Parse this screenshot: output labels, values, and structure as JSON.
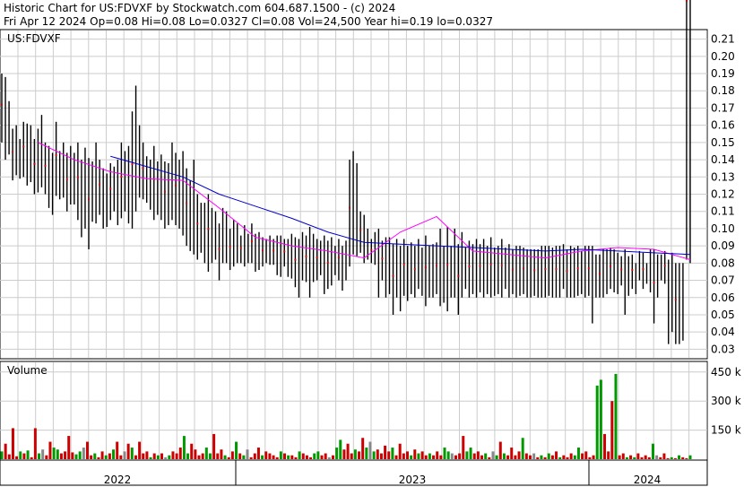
{
  "header": {
    "line1": "Historic Chart for US:FDVXF by Stockwatch.com 604.687.1500 - (c) 2024",
    "line2": "Fri Apr 12 2024  Op=0.08  Hi=0.08  Lo=0.0327  Cl=0.08  Vol=24,500  Year hi=0.19  lo=0.0327"
  },
  "chart_data": {
    "type": "line",
    "subtype": "ohlc-bars-with-moving-averages",
    "price_panel": {
      "symbol_label": "US:FDVXF",
      "ylim": [
        0.025,
        0.215
      ],
      "y_ticks": [
        0.21,
        0.2,
        0.19,
        0.18,
        0.17,
        0.16,
        0.15,
        0.14,
        0.13,
        0.12,
        0.11,
        0.1,
        0.09,
        0.08,
        0.07,
        0.06,
        0.05,
        0.04,
        0.03
      ],
      "y_tick_labels": [
        "0.21",
        "0.20",
        "0.19",
        "0.18",
        "0.17",
        "0.16",
        "0.15",
        "0.14",
        "0.13",
        "0.12",
        "0.11",
        "0.10",
        "0.09",
        "0.08",
        "0.07",
        "0.06",
        "0.05",
        "0.04",
        "0.03"
      ],
      "grid": true,
      "series": [
        {
          "kind": "hi-lo",
          "color": "#000000",
          "x": [
            0,
            2,
            4,
            6,
            8,
            10,
            12,
            14,
            16,
            18,
            20,
            22,
            24,
            26,
            28,
            30,
            32,
            34,
            36,
            38,
            40,
            42,
            44,
            46,
            48,
            50,
            52,
            54,
            56,
            58,
            60,
            62,
            64,
            66,
            68,
            70,
            72,
            74,
            76,
            78,
            80,
            82,
            84,
            86,
            88,
            90,
            92,
            94,
            96,
            98,
            100,
            102,
            104,
            106,
            108,
            110,
            112,
            114,
            116,
            118,
            120,
            122,
            124,
            126,
            128,
            130,
            132,
            134,
            136,
            138,
            140,
            142,
            144,
            146,
            148,
            150,
            152,
            154,
            156,
            158,
            160,
            162,
            164,
            166,
            168,
            170,
            172,
            174,
            176,
            178,
            180,
            182,
            184,
            186,
            188,
            190,
            192,
            194,
            196,
            198,
            200,
            202,
            204,
            206,
            208,
            210,
            212,
            214,
            216,
            218,
            220,
            222,
            224,
            226,
            228,
            230,
            232,
            234,
            236,
            238,
            240,
            242,
            244,
            246,
            248,
            250,
            252,
            254,
            256,
            258,
            260,
            262,
            264,
            266,
            268,
            270,
            272,
            274,
            276,
            278,
            280,
            282,
            284,
            286,
            288,
            290,
            292,
            294,
            296,
            298,
            300,
            302,
            304,
            306,
            308,
            310,
            312,
            314,
            316,
            318,
            320,
            322,
            324,
            326,
            328,
            330,
            332,
            334,
            336,
            338,
            340,
            342,
            344,
            346,
            348,
            350,
            352,
            354,
            356,
            358,
            360,
            362,
            364,
            366,
            368,
            370,
            372,
            374,
            376,
            378,
            380
          ],
          "high": [
            0.19,
            0.188,
            0.174,
            0.158,
            0.16,
            0.152,
            0.162,
            0.161,
            0.16,
            0.152,
            0.158,
            0.166,
            0.15,
            0.148,
            0.144,
            0.162,
            0.145,
            0.15,
            0.144,
            0.148,
            0.144,
            0.15,
            0.14,
            0.147,
            0.141,
            0.139,
            0.15,
            0.14,
            0.135,
            0.132,
            0.138,
            0.136,
            0.14,
            0.15,
            0.145,
            0.148,
            0.168,
            0.183,
            0.16,
            0.15,
            0.142,
            0.14,
            0.148,
            0.139,
            0.143,
            0.139,
            0.138,
            0.15,
            0.144,
            0.14,
            0.145,
            0.135,
            0.128,
            0.14,
            0.12,
            0.115,
            0.115,
            0.12,
            0.112,
            0.11,
            0.103,
            0.112,
            0.11,
            0.1,
            0.105,
            0.103,
            0.096,
            0.102,
            0.097,
            0.103,
            0.097,
            0.098,
            0.095,
            0.094,
            0.096,
            0.094,
            0.096,
            0.096,
            0.094,
            0.094,
            0.097,
            0.095,
            0.094,
            0.098,
            0.096,
            0.101,
            0.097,
            0.094,
            0.093,
            0.096,
            0.093,
            0.095,
            0.09,
            0.094,
            0.09,
            0.093,
            0.14,
            0.145,
            0.138,
            0.11,
            0.108,
            0.1,
            0.094,
            0.098,
            0.1,
            0.093,
            0.095,
            0.095,
            0.091,
            0.094,
            0.09,
            0.094,
            0.09,
            0.092,
            0.09,
            0.094,
            0.089,
            0.096,
            0.09,
            0.091,
            0.092,
            0.1,
            0.09,
            0.101,
            0.09,
            0.1,
            0.091,
            0.098,
            0.089,
            0.093,
            0.091,
            0.094,
            0.091,
            0.094,
            0.09,
            0.095,
            0.089,
            0.09,
            0.094,
            0.089,
            0.091,
            0.088,
            0.09,
            0.09,
            0.089,
            0.088,
            0.088,
            0.088,
            0.088,
            0.09,
            0.09,
            0.09,
            0.089,
            0.09,
            0.09,
            0.091,
            0.088,
            0.09,
            0.089,
            0.09,
            0.087,
            0.09,
            0.09,
            0.09,
            0.085,
            0.085,
            0.088,
            0.088,
            0.089,
            0.088,
            0.086,
            0.084,
            0.088,
            0.084,
            0.085,
            0.08,
            0.087,
            0.086,
            0.08,
            0.088,
            0.088,
            0.085,
            0.085,
            0.087,
            0.082,
            0.086,
            0.08,
            0.08,
            0.08,
            0.082,
            0.08
          ],
          "low": [
            0.15,
            0.14,
            0.143,
            0.128,
            0.131,
            0.129,
            0.13,
            0.125,
            0.127,
            0.12,
            0.121,
            0.124,
            0.12,
            0.112,
            0.108,
            0.119,
            0.117,
            0.118,
            0.11,
            0.114,
            0.114,
            0.105,
            0.095,
            0.1,
            0.088,
            0.104,
            0.103,
            0.108,
            0.1,
            0.101,
            0.105,
            0.11,
            0.102,
            0.106,
            0.11,
            0.103,
            0.1,
            0.11,
            0.118,
            0.117,
            0.115,
            0.111,
            0.105,
            0.108,
            0.105,
            0.1,
            0.102,
            0.105,
            0.102,
            0.1,
            0.096,
            0.09,
            0.087,
            0.085,
            0.082,
            0.086,
            0.08,
            0.075,
            0.08,
            0.082,
            0.07,
            0.08,
            0.08,
            0.076,
            0.078,
            0.08,
            0.08,
            0.078,
            0.08,
            0.08,
            0.075,
            0.076,
            0.078,
            0.08,
            0.079,
            0.079,
            0.073,
            0.072,
            0.078,
            0.072,
            0.071,
            0.066,
            0.06,
            0.07,
            0.069,
            0.06,
            0.069,
            0.07,
            0.073,
            0.062,
            0.065,
            0.067,
            0.073,
            0.07,
            0.064,
            0.07,
            0.078,
            0.085,
            0.084,
            0.086,
            0.08,
            0.082,
            0.08,
            0.079,
            0.06,
            0.07,
            0.06,
            0.062,
            0.05,
            0.06,
            0.052,
            0.061,
            0.058,
            0.062,
            0.06,
            0.065,
            0.061,
            0.055,
            0.06,
            0.06,
            0.062,
            0.055,
            0.057,
            0.052,
            0.06,
            0.06,
            0.05,
            0.06,
            0.065,
            0.06,
            0.062,
            0.06,
            0.063,
            0.06,
            0.062,
            0.06,
            0.061,
            0.062,
            0.06,
            0.065,
            0.06,
            0.062,
            0.06,
            0.061,
            0.062,
            0.06,
            0.06,
            0.061,
            0.06,
            0.06,
            0.06,
            0.061,
            0.06,
            0.06,
            0.06,
            0.065,
            0.06,
            0.06,
            0.06,
            0.061,
            0.062,
            0.06,
            0.061,
            0.045,
            0.06,
            0.06,
            0.06,
            0.062,
            0.065,
            0.063,
            0.062,
            0.067,
            0.05,
            0.061,
            0.065,
            0.062,
            0.07,
            0.065,
            0.068,
            0.063,
            0.045,
            0.06,
            0.07,
            0.068,
            0.033,
            0.04,
            0.033,
            0.033,
            0.035
          ]
        },
        {
          "kind": "close-dots",
          "color": "#cc0000",
          "note": "close marks"
        },
        {
          "kind": "moving-average",
          "color": "#ff00ff",
          "x": [
            20,
            40,
            60,
            80,
            100,
            120,
            140,
            160,
            180,
            200,
            220,
            240,
            260,
            280,
            300,
            320,
            340,
            360,
            380
          ],
          "values": [
            0.15,
            0.14,
            0.133,
            0.129,
            0.128,
            0.112,
            0.095,
            0.09,
            0.087,
            0.083,
            0.098,
            0.107,
            0.087,
            0.085,
            0.083,
            0.087,
            0.089,
            0.088,
            0.082
          ]
        },
        {
          "kind": "moving-average",
          "color": "#0000cc",
          "x": [
            60,
            80,
            100,
            120,
            140,
            160,
            180,
            200,
            220,
            240,
            260,
            280,
            300,
            320,
            340,
            360,
            380
          ],
          "values": [
            0.142,
            0.136,
            0.13,
            0.12,
            0.113,
            0.106,
            0.098,
            0.092,
            0.091,
            0.09,
            0.089,
            0.088,
            0.087,
            0.088,
            0.087,
            0.086,
            0.085
          ]
        }
      ]
    },
    "volume_panel": {
      "title": "Volume",
      "ylim": [
        0,
        500000
      ],
      "y_ticks": [
        150000,
        300000,
        450000
      ],
      "y_tick_labels": [
        "150 k",
        "300 k",
        "450 k"
      ],
      "x_labels": [
        "2022",
        "2023",
        "2024"
      ],
      "series": [
        {
          "name": "",
          "color": "#cc0000"
        },
        {
          "name": "",
          "color": "#009900"
        },
        {
          "name": "",
          "color": "#888888"
        }
      ],
      "values": [
        40000,
        80000,
        25000,
        160000,
        15000,
        40000,
        30000,
        45000,
        10000,
        160000,
        30000,
        50000,
        20000,
        90000,
        60000,
        50000,
        30000,
        40000,
        120000,
        35000,
        25000,
        40000,
        60000,
        90000,
        20000,
        30000,
        10000,
        40000,
        20000,
        30000,
        50000,
        90000,
        20000,
        40000,
        80000,
        60000,
        20000,
        90000,
        30000,
        40000,
        10000,
        30000,
        20000,
        30000,
        10000,
        20000,
        40000,
        30000,
        60000,
        120000,
        30000,
        80000,
        50000,
        20000,
        30000,
        60000,
        30000,
        130000,
        30000,
        50000,
        20000,
        10000,
        40000,
        90000,
        30000,
        20000,
        50000,
        10000,
        30000,
        60000,
        20000,
        40000,
        30000,
        20000,
        10000,
        40000,
        30000,
        20000,
        20000,
        10000,
        40000,
        30000,
        20000,
        10000,
        30000,
        40000,
        20000,
        30000,
        10000,
        20000,
        60000,
        100000,
        50000,
        80000,
        30000,
        50000,
        40000,
        110000,
        60000,
        90000,
        40000,
        50000,
        30000,
        70000,
        40000,
        60000,
        20000,
        80000,
        30000,
        40000,
        20000,
        50000,
        30000,
        40000,
        20000,
        30000,
        20000,
        40000,
        20000,
        60000,
        40000,
        30000,
        20000,
        30000,
        120000,
        40000,
        60000,
        30000,
        40000,
        20000,
        30000,
        10000,
        40000,
        20000,
        90000,
        30000,
        20000,
        60000,
        20000,
        40000,
        110000,
        30000,
        20000,
        30000,
        10000,
        20000,
        10000,
        30000,
        20000,
        40000,
        10000,
        20000,
        10000,
        30000,
        20000,
        60000,
        30000,
        40000,
        10000,
        20000,
        380000,
        410000,
        130000,
        40000,
        300000,
        440000,
        20000,
        30000,
        10000,
        20000,
        10000,
        30000,
        10000,
        20000,
        10000,
        80000,
        20000,
        10000,
        30000,
        5000,
        10000,
        5000,
        20000,
        10000,
        5000,
        20000
      ]
    }
  }
}
